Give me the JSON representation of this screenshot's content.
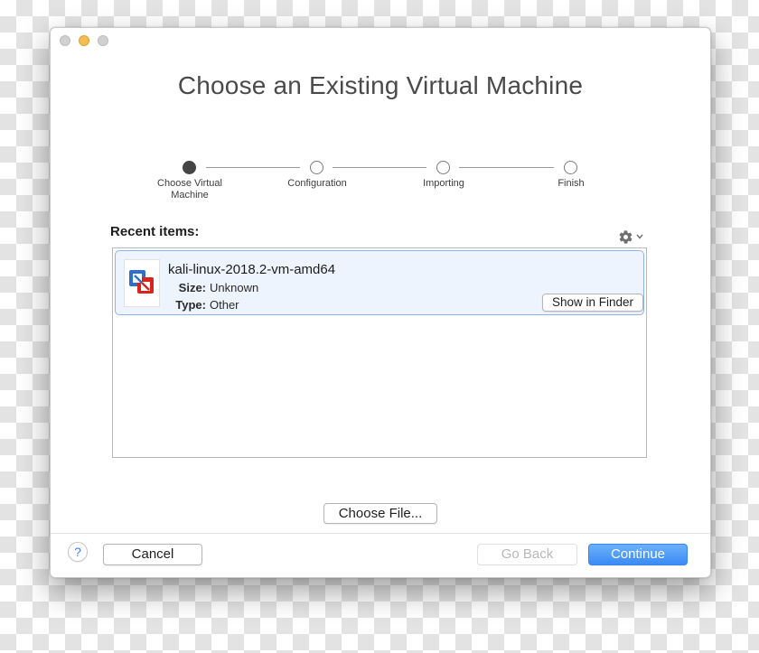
{
  "window": {
    "title": "Choose an Existing Virtual Machine"
  },
  "steps": [
    {
      "label": "Choose Virtual Machine",
      "active": true
    },
    {
      "label": "Configuration",
      "active": false
    },
    {
      "label": "Importing",
      "active": false
    },
    {
      "label": "Finish",
      "active": false
    }
  ],
  "recent": {
    "label": "Recent items:",
    "items": [
      {
        "name": "kali-linux-2018.2-vm-amd64",
        "size_label": "Size:",
        "size_value": "Unknown",
        "type_label": "Type:",
        "type_value": "Other",
        "show_button": "Show in Finder"
      }
    ]
  },
  "buttons": {
    "choose_file": "Choose File...",
    "help": "?",
    "cancel": "Cancel",
    "go_back": "Go Back",
    "continue": "Continue"
  },
  "icons": {
    "gear": "gear-icon",
    "chevron": "chevron-down-icon",
    "vm": "vmware-fusion-icon"
  },
  "colors": {
    "accent": "#3a8af5",
    "selection_border": "#8fb2ec",
    "selection_fill": "#eef4fe",
    "minimize": "#f5bd4f"
  }
}
